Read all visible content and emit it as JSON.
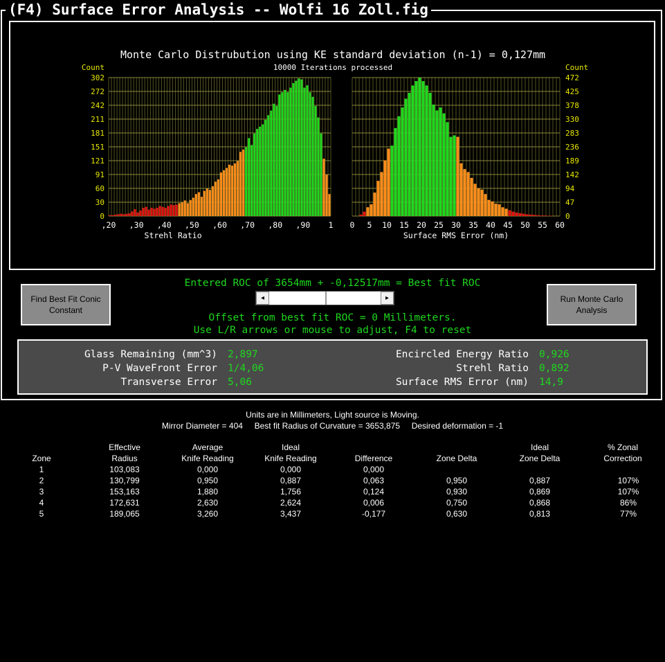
{
  "window": {
    "title": "(F4) Surface Error Analysis -- Wolfi 16 Zoll.fig"
  },
  "chart_data": [
    {
      "type": "bar",
      "title": "Monte Carlo Distrubution using KE standard deviation (n-1) = 0,127mm",
      "subtitle": "10000 Iterations processed",
      "xlabel": "Strehl Ratio",
      "ylabel": "Count",
      "xlim": [
        0.2,
        1.0
      ],
      "ylim": [
        0,
        302
      ],
      "x_tick_labels": [
        ",20",
        ",30",
        ",40",
        ",50",
        ",60",
        ",70",
        ",80",
        ",90",
        "1"
      ],
      "y_tick_labels": [
        "0",
        "30",
        "60",
        "91",
        "121",
        "151",
        "181",
        "211",
        "242",
        "272",
        "302"
      ],
      "grid": true,
      "bar_colors": {
        "low": "#e01010",
        "mid": "#ff8c1a",
        "high": "#1ed81e"
      },
      "color_thresholds": [
        0.45,
        0.69
      ],
      "bins": {
        "x_start": 0.2,
        "bin_width": 0.01,
        "values": [
          2,
          2,
          3,
          4,
          5,
          4,
          5,
          6,
          10,
          15,
          8,
          12,
          18,
          20,
          14,
          18,
          16,
          18,
          22,
          20,
          18,
          22,
          25,
          24,
          25,
          28,
          30,
          34,
          28,
          35,
          40,
          48,
          52,
          42,
          55,
          60,
          57,
          65,
          75,
          80,
          95,
          100,
          105,
          112,
          110,
          115,
          120,
          140,
          145,
          150,
          170,
          155,
          180,
          190,
          195,
          200,
          210,
          220,
          230,
          245,
          240,
          265,
          270,
          275,
          270,
          280,
          290,
          295,
          300,
          298,
          280,
          285,
          270,
          260,
          240,
          215,
          180,
          125,
          90,
          48
        ]
      }
    },
    {
      "type": "bar",
      "xlabel": "Surface RMS Error (nm)",
      "ylabel": "Count",
      "xlim": [
        0,
        60
      ],
      "ylim": [
        0,
        472
      ],
      "x_tick_labels": [
        "0",
        "5",
        "10",
        "15",
        "20",
        "25",
        "30",
        "35",
        "40",
        "45",
        "50",
        "55",
        "60"
      ],
      "y_tick_labels": [
        "0",
        "47",
        "94",
        "142",
        "189",
        "236",
        "283",
        "330",
        "378",
        "425",
        "472"
      ],
      "grid": true,
      "bar_colors": {
        "low": "#e01010",
        "mid": "#ff8c1a",
        "high": "#1ed81e"
      },
      "color_thresholds": [
        11.5,
        30.5
      ],
      "color_order": "mid-high-mid-low",
      "bins": {
        "x_start": 0,
        "bin_width": 1,
        "values": [
          0,
          0,
          5,
          15,
          30,
          40,
          80,
          120,
          150,
          190,
          230,
          240,
          300,
          340,
          370,
          400,
          420,
          445,
          460,
          472,
          460,
          445,
          420,
          380,
          360,
          370,
          350,
          320,
          270,
          275,
          270,
          180,
          160,
          150,
          130,
          110,
          95,
          90,
          75,
          55,
          50,
          42,
          40,
          30,
          25,
          20,
          15,
          12,
          10,
          8,
          6,
          5,
          4,
          3,
          2,
          2,
          1,
          1,
          0,
          0
        ]
      }
    }
  ],
  "buttons": {
    "find_conic": "Find Best Fit Conic Constant",
    "run_monte": "Run Monte Carlo Analysis"
  },
  "roc_line": "Entered ROC of 3654mm + -0,12517mm = Best fit ROC",
  "offset_line": "Offset from best fit ROC = 0 Millimeters.",
  "hint_line": "Use L/R arrows or mouse to adjust, F4 to reset",
  "slider": {
    "left_arrow": "◂",
    "right_arrow": "▸",
    "value": 0.5
  },
  "results": {
    "glass_label": "Glass Remaining (mm^3)",
    "glass_value": "2,897",
    "pv_label": "P-V WaveFront Error",
    "pv_value": "1/4,06",
    "transverse_label": "Transverse Error",
    "transverse_value": "5,06",
    "encircled_label": "Encircled Energy Ratio",
    "encircled_value": "0,926",
    "strehl_label": "Strehl Ratio",
    "strehl_value": "0,892",
    "rms_label": "Surface RMS Error (nm)",
    "rms_value": "14,9"
  },
  "info": {
    "line1": "Units are in Millimeters, Light source is Moving.",
    "line2": "Mirror Diameter = 404     Best fit Radius of Curvature = 3653,875     Desired deformation = -1"
  },
  "table": {
    "headers": [
      [
        "",
        "Zone"
      ],
      [
        "Effective",
        "Radius"
      ],
      [
        "Average",
        "Knife Reading"
      ],
      [
        "Ideal",
        "Knife Reading"
      ],
      [
        "",
        "Difference"
      ],
      [
        "",
        "Zone Delta"
      ],
      [
        "Ideal",
        "Zone Delta"
      ],
      [
        "% Zonal",
        "Correction"
      ]
    ],
    "rows": [
      [
        "1",
        "103,083",
        "0,000",
        "0,000",
        "0,000",
        "",
        "",
        ""
      ],
      [
        "2",
        "130,799",
        "0,950",
        "0,887",
        "0,063",
        "0,950",
        "0,887",
        "107%"
      ],
      [
        "3",
        "153,163",
        "1,880",
        "1,756",
        "0,124",
        "0,930",
        "0,869",
        "107%"
      ],
      [
        "4",
        "172,631",
        "2,630",
        "2,624",
        "0,006",
        "0,750",
        "0,868",
        "86%"
      ],
      [
        "5",
        "189,065",
        "3,260",
        "3,437",
        "-0,177",
        "0,630",
        "0,813",
        "77%"
      ]
    ]
  }
}
